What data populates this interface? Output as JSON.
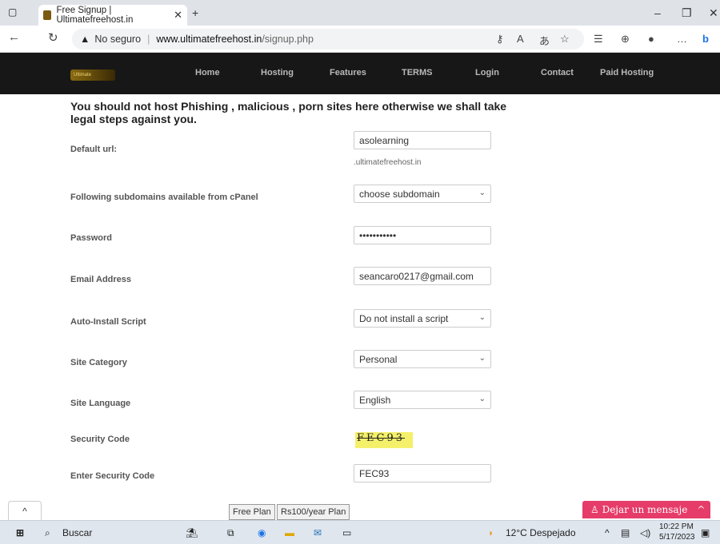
{
  "browser": {
    "tab_title": "Free Signup | Ultimatefreehost.in",
    "url_warning": "No seguro",
    "url_domain": "www.ultimatefreehost.in",
    "url_path": "/signup.php"
  },
  "nav": {
    "items": [
      "Home",
      "Hosting",
      "Features",
      "TERMS",
      "Login",
      "Contact",
      "Paid Hosting"
    ]
  },
  "notice": "You should not host Phishing , malicious , porn sites here otherwise we shall take legal steps against you.",
  "form": {
    "default_url": {
      "label": "Default url:",
      "value": "asolearning",
      "hint": ".ultimatefreehost.in"
    },
    "subdomain": {
      "label": "Following subdomains available from cPanel",
      "value": "choose subdomain"
    },
    "password": {
      "label": "Password",
      "value": "•••••••••••"
    },
    "email": {
      "label": "Email Address",
      "value": "seancaro0217@gmail.com"
    },
    "script": {
      "label": "Auto-Install Script",
      "value": "Do not install a script"
    },
    "category": {
      "label": "Site Category",
      "value": "Personal"
    },
    "language": {
      "label": "Site Language",
      "value": "English"
    },
    "security": {
      "label": "Security Code",
      "captcha": "FEC93"
    },
    "enter_code": {
      "label": "Enter Security Code",
      "value": "FEC93"
    }
  },
  "bottom": {
    "free_plan": "Free Plan",
    "paid_plan": "Rs100/year Plan",
    "chat": "Dejar un mensaje"
  },
  "taskbar": {
    "search": "Buscar",
    "weather": "12°C Despejado",
    "time": "10:22 PM",
    "date": "5/17/2023"
  }
}
